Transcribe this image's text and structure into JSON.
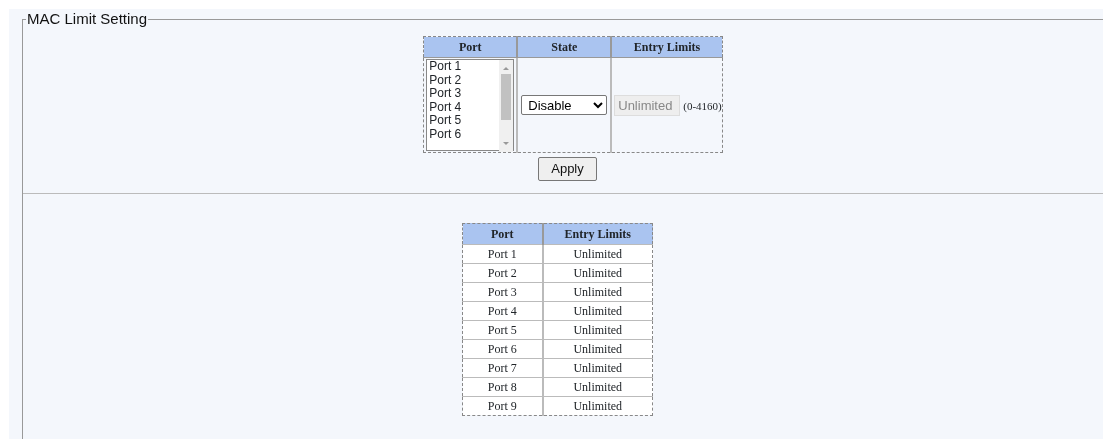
{
  "section": {
    "title": "MAC Limit Setting"
  },
  "config_table": {
    "columns": [
      "Port",
      "State",
      "Entry Limits"
    ],
    "port_list": [
      {
        "label": "Port 1",
        "selected": false
      },
      {
        "label": "Port 2",
        "selected": false
      },
      {
        "label": "Port 3",
        "selected": false
      },
      {
        "label": "Port 4",
        "selected": false
      },
      {
        "label": "Port 5",
        "selected": false
      },
      {
        "label": "Port 6",
        "selected": false
      }
    ],
    "state": {
      "value": "Disable"
    },
    "entry_limit": {
      "value": "Unlimited",
      "disabled": true
    },
    "range": "(0-4160)"
  },
  "apply_button": "Apply",
  "status_table": {
    "columns": [
      "Port",
      "Entry Limits"
    ],
    "rows": [
      [
        "Port 1",
        "Unlimited"
      ],
      [
        "Port 2",
        "Unlimited"
      ],
      [
        "Port 3",
        "Unlimited"
      ],
      [
        "Port 4",
        "Unlimited"
      ],
      [
        "Port 5",
        "Unlimited"
      ],
      [
        "Port 6",
        "Unlimited"
      ],
      [
        "Port 7",
        "Unlimited"
      ],
      [
        "Port 8",
        "Unlimited"
      ],
      [
        "Port 9",
        "Unlimited"
      ]
    ]
  }
}
